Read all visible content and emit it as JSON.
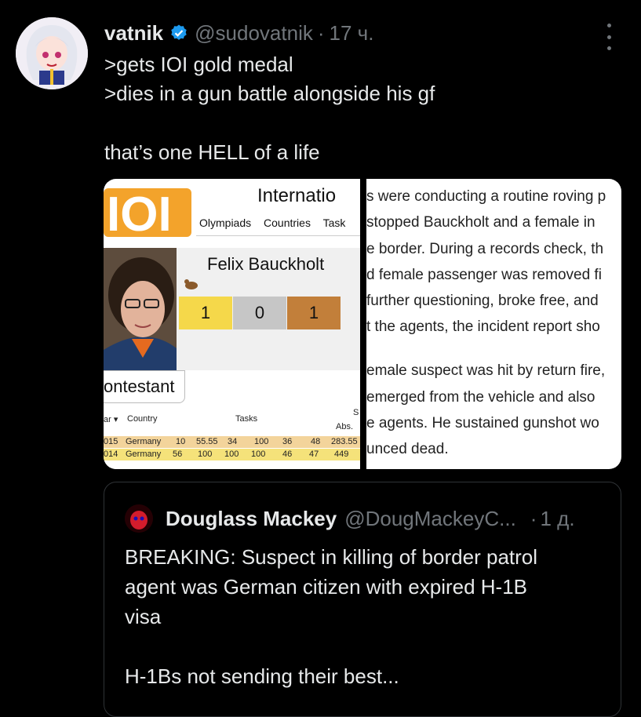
{
  "tweet": {
    "author_name": "vatnik",
    "handle": "@sudovatnik",
    "separator": "·",
    "time": "17 ч.",
    "lines": [
      ">gets IOI gold medal",
      ">dies in a gun battle alongside his gf",
      "",
      "that’s one HELL of a life"
    ]
  },
  "media_left": {
    "logo_text": "IOI",
    "site_title": "Internatio",
    "nav": [
      "Olympiads",
      "Countries",
      "Task"
    ],
    "person_name": "Felix Bauckholt",
    "medals": {
      "gold": "1",
      "silver": "0",
      "bronze": "1"
    },
    "contestant_label": "ontestant",
    "table_headers": {
      "year": "ar ▾",
      "country": "Country",
      "tasks": "Tasks",
      "score_top": "S",
      "abs": "Abs."
    },
    "rows": [
      {
        "year": "015",
        "country": "Germany",
        "t": [
          "10",
          "55.55",
          "34",
          "100",
          "36",
          "48"
        ],
        "abs": "283.55"
      },
      {
        "year": "014",
        "country": "Germany",
        "t": [
          "56",
          "100",
          "100",
          "100",
          "46",
          "47"
        ],
        "abs": "449"
      }
    ]
  },
  "media_right": {
    "lines": [
      "s were conducting a routine roving p",
      "stopped Bauckholt and a female in",
      "e border. During a records check, th",
      "d female passenger was removed fi",
      "further questioning, broke free, and",
      "t the agents, the incident report sho",
      "",
      "emale suspect was hit by return fire,",
      "emerged from the vehicle and also",
      "e agents. He sustained gunshot wo",
      "unced dead."
    ]
  },
  "quote": {
    "author_name": "Douglass Mackey",
    "handle": "@DougMackeyC...",
    "separator": "·",
    "time": "1 д.",
    "lines": [
      "BREAKING: Suspect in killing of border patrol",
      "agent was German citizen with expired H-1B",
      "visa",
      "",
      "H-1Bs not sending their best..."
    ]
  },
  "icons": {
    "verified": "verified-badge-icon",
    "more": "more-options-icon"
  },
  "colors": {
    "verified": "#1d9bf0",
    "secondary_text": "#71767b"
  }
}
